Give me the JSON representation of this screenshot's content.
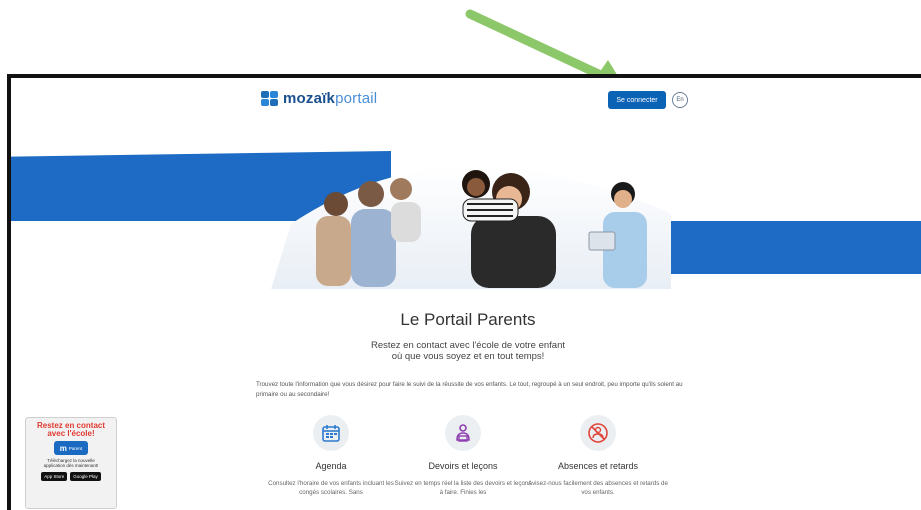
{
  "header": {
    "logo_bold": "mozaïk",
    "logo_light": "portail",
    "connect_label": "Se connecter",
    "lang_label": "En"
  },
  "main": {
    "title": "Le Portail Parents",
    "subtitle_line1": "Restez en contact avec l'école de votre enfant",
    "subtitle_line2": "où que vous soyez et en tout temps!",
    "intro": "Trouvez toute l'information que vous désirez pour faire le suivi de la réussite de vos enfants. Le tout, regroupé à un seul endroit, peu importe qu'ils soient au primaire ou au secondaire!"
  },
  "features": [
    {
      "title": "Agenda",
      "desc": "Consultez l'horaire de vos enfants incluant les congés scolaires. Sans"
    },
    {
      "title": "Devoirs et leçons",
      "desc": "Suivez en temps réel la liste des devoirs et leçons à faire. Finies les"
    },
    {
      "title": "Absences et retards",
      "desc": "Avisez-nous facilement des absences et retards de vos enfants."
    }
  ],
  "promo": {
    "title_line1": "Restez en contact",
    "title_line2": "avec l'école!",
    "app_label": "Parent",
    "desc_line1": "Téléchargez la nouvelle",
    "desc_line2": "application dès maintenant!",
    "store1": "App Store",
    "store2": "Google Play"
  },
  "colors": {
    "primary_blue": "#0b63b6",
    "banner_blue": "#1d6bc4",
    "arrow_green": "#8cc86a",
    "promo_red": "#e03a31"
  }
}
